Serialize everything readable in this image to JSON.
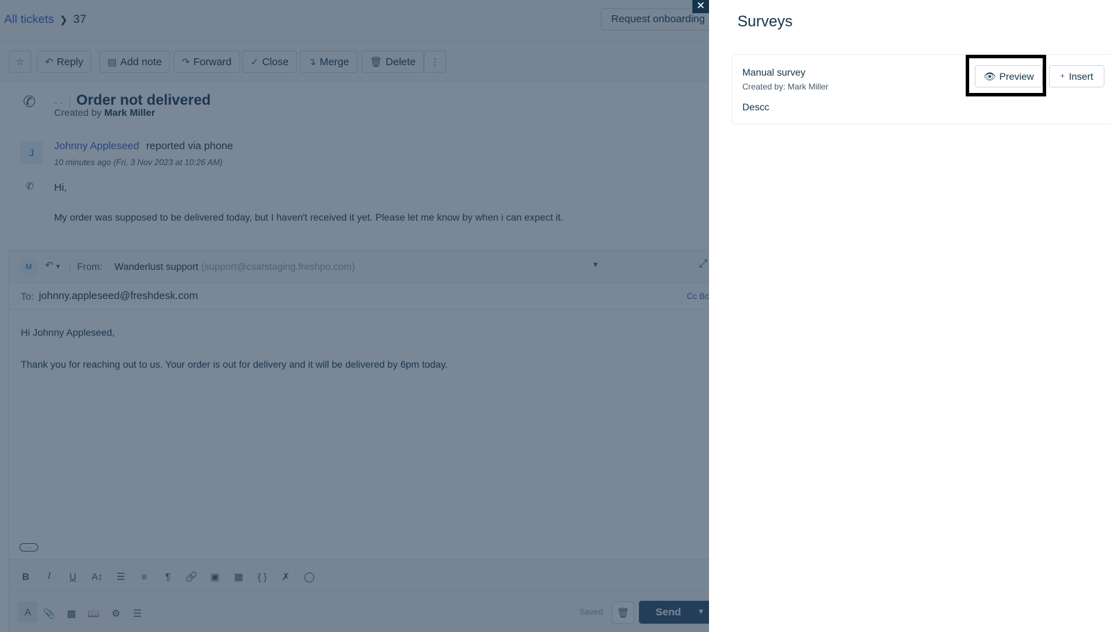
{
  "header": {
    "breadcrumb_link": "All tickets",
    "ticket_number": "37",
    "onboarding_label": "Request onboarding"
  },
  "toolbar": {
    "reply": "Reply",
    "add_note": "Add note",
    "forward": "Forward",
    "close": "Close",
    "merge": "Merge",
    "delete": "Delete"
  },
  "ticket": {
    "subject": "Order not delivered",
    "dashes": "- -",
    "created_by_label": "Created by",
    "created_by_name": "Mark Miller"
  },
  "message": {
    "avatar_initial": "J",
    "sender": "Johnny Appleseed",
    "via": "reported via phone",
    "timestamp": "10 minutes ago (Fri, 3 Nov 2023 at 10:26 AM)",
    "greeting": "Hi,",
    "body": "My order was supposed to be delivered today, but I haven't received it yet. Please let me know by when i can expect it."
  },
  "editor": {
    "avatar_initial": "M",
    "from_label": "From:",
    "from_name": "Wanderlust support",
    "from_email": "(support@csatstaging.freshpo.com)",
    "to_label": "To:",
    "to_value": "johnny.appleseed@freshdesk.com",
    "cc_bcc": "Cc  Bcc",
    "greeting": "Hi Johnny Appleseed,",
    "body": "Thank you for reaching out to us. Your order is out for delivery and it will be delivered by 6pm today.",
    "saved": "Saved",
    "send": "Send"
  },
  "panel": {
    "title": "Surveys",
    "survey": {
      "name": "Manual survey",
      "created_by": "Created by: Mark Miller",
      "description": "Descc",
      "preview_label": "Preview",
      "insert_label": "Insert"
    }
  },
  "colors": {
    "accent": "#2c5cc5",
    "send_button": "#264966",
    "overlay": "#213750",
    "highlight_border": "#000000"
  }
}
